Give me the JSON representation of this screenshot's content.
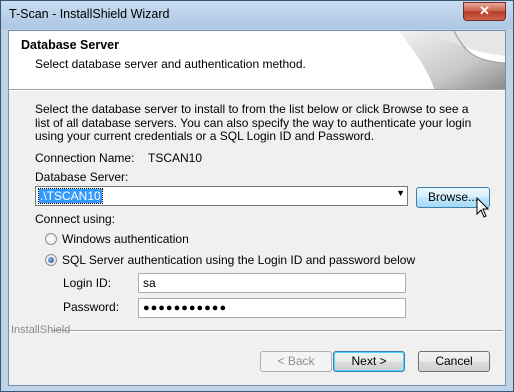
{
  "window": {
    "title": "T-Scan - InstallShield Wizard",
    "close_glyph": "✕"
  },
  "header": {
    "title": "Database Server",
    "subtitle": "Select database server and authentication method."
  },
  "intro": "Select the database server to install to from the list below or click Browse to see a list of all database servers. You can also specify the way to authenticate your login using your current credentials or a SQL Login ID and Password.",
  "connection": {
    "label": "Connection Name:",
    "value": "TSCAN10"
  },
  "database_server": {
    "label": "Database Server:",
    "value": ".\\TSCAN10",
    "dropdown_glyph": "▼"
  },
  "browse_label": "Browse...",
  "connect_using": {
    "label": "Connect using:",
    "options": [
      {
        "label": "Windows authentication",
        "selected": false
      },
      {
        "label": "SQL Server authentication using the Login ID and password below",
        "selected": true
      }
    ]
  },
  "login": {
    "label": "Login ID:",
    "value": "sa"
  },
  "password": {
    "label": "Password:",
    "value": "●●●●●●●●●●●"
  },
  "brand": "InstallShield",
  "buttons": {
    "back": "< Back",
    "next": "Next >",
    "cancel": "Cancel"
  },
  "colors": {
    "selection": "#3399ff",
    "titlebar": "#bcd3ea",
    "close": "#c95a45"
  },
  "icons": {
    "close": "close-icon",
    "dropdown": "chevron-down-icon",
    "cursor": "mouse-cursor-icon"
  }
}
